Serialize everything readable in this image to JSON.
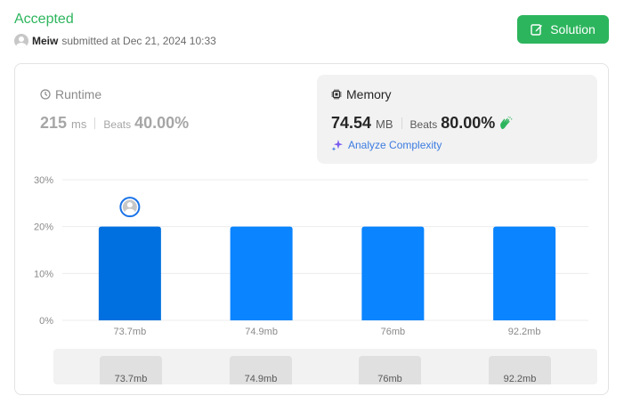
{
  "header": {
    "status": "Accepted",
    "user": "Meiw",
    "submitted_text": "submitted at Dec 21, 2024 10:33",
    "solution_label": "Solution"
  },
  "runtime": {
    "title": "Runtime",
    "value": "215",
    "unit": "ms",
    "beats_label": "Beats",
    "beats_value": "40.00%"
  },
  "memory": {
    "title": "Memory",
    "value": "74.54",
    "unit": "MB",
    "beats_label": "Beats",
    "beats_value": "80.00%",
    "analyze_label": "Analyze Complexity"
  },
  "colors": {
    "accent_green": "#2db55d",
    "bar_blue": "#0a84ff",
    "bar_selected": "#0070e0"
  },
  "chart_data": {
    "type": "bar",
    "categories": [
      "73.7mb",
      "74.9mb",
      "76mb",
      "92.2mb"
    ],
    "values": [
      20,
      20,
      20,
      20
    ],
    "selected_index": 0,
    "yticks": [
      "0%",
      "10%",
      "20%",
      "30%"
    ],
    "ylim": [
      0,
      30
    ],
    "grid": true
  },
  "mini_chart": {
    "labels": [
      "73.7mb",
      "74.9mb",
      "76mb",
      "92.2mb"
    ]
  }
}
